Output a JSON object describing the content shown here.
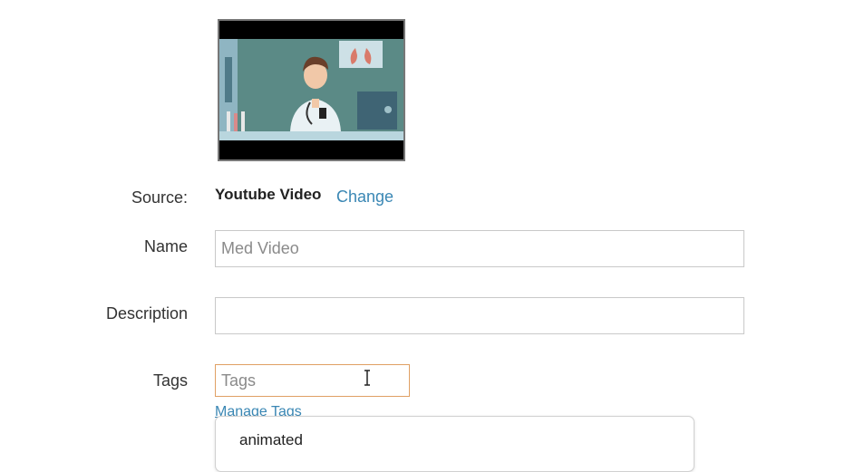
{
  "video": {
    "thumbnail_icon": "video-thumbnail-doctor-illustration"
  },
  "source": {
    "label": "Source:",
    "value": "Youtube Video",
    "change_label": "Change"
  },
  "name": {
    "label": "Name",
    "value": "",
    "placeholder": "Med Video"
  },
  "description": {
    "label": "Description",
    "value": "",
    "placeholder": ""
  },
  "tags": {
    "label": "Tags",
    "value": "",
    "placeholder": "Tags",
    "manage_label": "Manage Tags",
    "suggestions": [
      "animated"
    ]
  },
  "colors": {
    "link": "#3a87b4",
    "focus_border": "#e0a064"
  }
}
